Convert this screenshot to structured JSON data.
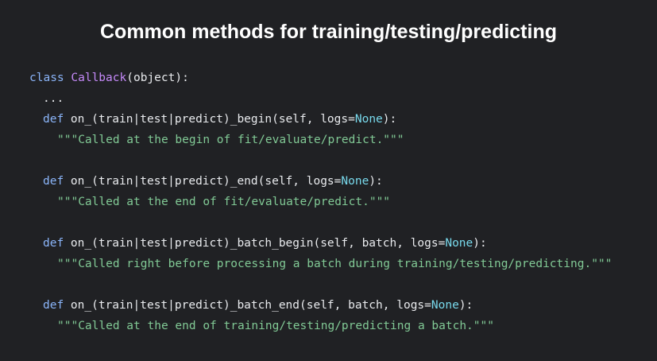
{
  "title": "Common methods for training/testing/predicting",
  "code": {
    "class_line": {
      "kw": "class",
      "sp": " ",
      "name": "Callback",
      "rest": "(object):"
    },
    "ellipsis": "...",
    "methods": [
      {
        "kw": "def",
        "signature": " on_(train|test|predict)_begin(self, logs=",
        "none": "None",
        "close": "):",
        "docstring": "\"\"\"Called at the begin of fit/evaluate/predict.\"\"\""
      },
      {
        "kw": "def",
        "signature": " on_(train|test|predict)_end(self, logs=",
        "none": "None",
        "close": "):",
        "docstring": "\"\"\"Called at the end of fit/evaluate/predict.\"\"\""
      },
      {
        "kw": "def",
        "signature": " on_(train|test|predict)_batch_begin(self, batch, logs=",
        "none": "None",
        "close": "):",
        "docstring": "\"\"\"Called right before processing a batch during training/testing/predicting.\"\"\""
      },
      {
        "kw": "def",
        "signature": " on_(train|test|predict)_batch_end(self, batch, logs=",
        "none": "None",
        "close": "):",
        "docstring": "\"\"\"Called at the end of training/testing/predicting a batch.\"\"\""
      }
    ]
  },
  "colors": {
    "background": "#202124",
    "keyword": "#8ab4f8",
    "class_name": "#c58af9",
    "none_literal": "#78d9ec",
    "string": "#81c995",
    "text": "#e8eaed"
  }
}
